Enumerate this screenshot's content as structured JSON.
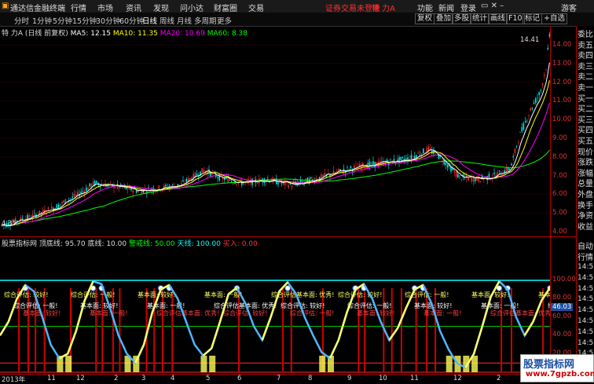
{
  "topbar": {
    "app_title": "通达信金融终端",
    "menu": [
      "行情",
      "市场",
      "资讯",
      "发现",
      "问小达",
      "财富圈",
      "交易"
    ],
    "alert": "证券交易未登录",
    "stock": "特 力A",
    "right_menu": [
      "功能",
      "新闻",
      "登录",
      "游客"
    ]
  },
  "periodbar": {
    "periods": [
      "分时",
      "1分钟",
      "5分钟",
      "15分钟",
      "30分钟",
      "60分钟",
      "日线",
      "周线",
      "月线",
      "多周期",
      "更多"
    ],
    "active": "日线",
    "tools": [
      "复权",
      "叠加",
      "多股",
      "统计",
      "画线",
      "F10",
      "标记",
      "+自选"
    ]
  },
  "main": {
    "legend_name": "特 力A",
    "legend_type": "(日线 前复权)",
    "ma5": "MA5: 12.15",
    "ma10": "MA10: 11.35",
    "ma20": "MA20: 10.69",
    "ma60": "MA60: 8.38",
    "high_label": "14.41",
    "low_label": "4.35",
    "colors": {
      "ma5": "#ffffff",
      "ma10": "#ffff00",
      "ma20": "#ff00ff",
      "ma60": "#00ff00"
    },
    "yaxis": [
      "14.00",
      "13.00",
      "12.00",
      "11.00",
      "10.00",
      "9.00",
      "8.00",
      "7.00",
      "6.00",
      "5.00",
      "4.00"
    ]
  },
  "indicator": {
    "name": "股票指标网",
    "bottom_line": "顶底线: 95.70",
    "floor": "底线: 10.00",
    "warning": "警戒线: 50.00",
    "sky": "天线: 100.00",
    "buy": "买入: 0.00",
    "yaxis": [
      "100.00",
      "80.00",
      "60.00",
      "40.00",
      "20.00"
    ],
    "current": "46.03",
    "texts": [
      "综合评估: 较好!",
      "综合评估: 一般!",
      "基本面: 较好!",
      "基本面: 一般!",
      "综合评估基本面: 优秀!"
    ],
    "series": [
      40,
      55,
      80,
      95,
      88,
      60,
      30,
      15,
      20,
      45,
      78,
      99,
      96,
      70,
      40,
      20,
      10,
      30,
      65,
      90,
      95,
      80,
      55,
      30,
      18,
      26,
      55,
      85,
      92,
      75,
      50,
      35,
      60,
      88,
      98,
      85,
      60,
      40,
      22,
      15,
      35,
      65,
      90,
      96,
      80,
      55,
      35,
      48,
      70,
      90,
      95,
      75,
      45,
      25,
      10,
      5,
      20,
      50,
      82,
      99,
      90,
      60,
      40,
      55,
      78,
      92
    ]
  },
  "xaxis": [
    "2013年",
    "11",
    "12",
    "2",
    "3",
    "4",
    "5",
    "6",
    "7",
    "8",
    "9",
    "10",
    "11",
    "12",
    "2",
    "3"
  ],
  "right_panel": {
    "labels": [
      "委比",
      "卖五",
      "卖四",
      "卖三",
      "卖二",
      "卖一",
      "买一",
      "买二",
      "买三",
      "买四",
      "买五",
      "现价",
      "涨跌",
      "涨幅",
      "总量",
      "外盘",
      "换手",
      "净资",
      "收益"
    ],
    "bottom_labels": [
      "自动",
      "行情"
    ],
    "times": [
      "14:5",
      "14:5",
      "14:5",
      "14:5",
      "14:5",
      "14:5",
      "14:5",
      "14:5",
      "14:5"
    ]
  },
  "watermark": {
    "title": "股票指标网",
    "url": "www.7gpzb.com"
  }
}
